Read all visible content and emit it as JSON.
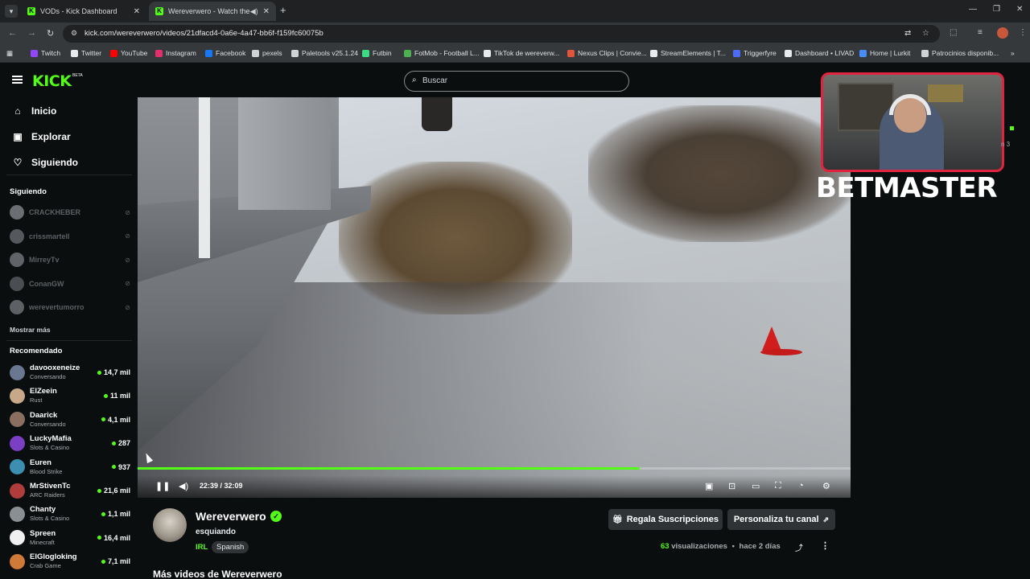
{
  "browser": {
    "tabs": [
      {
        "title": "VODs - Kick Dashboard",
        "active": false
      },
      {
        "title": "Wereverwero - Watch the V",
        "active": true
      }
    ],
    "url": "kick.com/wereverwero/videos/21dfacd4-0a6e-4a47-bb6f-f159fc60075b",
    "bookmarks": [
      {
        "label": "Twitch",
        "color": "#9146ff"
      },
      {
        "label": "Twitter",
        "color": "#e8eaed"
      },
      {
        "label": "YouTube",
        "color": "#ff0000"
      },
      {
        "label": "Instagram",
        "color": "#e1306c"
      },
      {
        "label": "Facebook",
        "color": "#1877f2"
      },
      {
        "label": "pexels",
        "color": "#cfd3d6"
      },
      {
        "label": "Paletools v25.1.24",
        "color": "#cfd3d6"
      },
      {
        "label": "Futbin",
        "color": "#3ddc84"
      },
      {
        "label": "FotMob - Football L...",
        "color": "#4caf50"
      },
      {
        "label": "TikTok de wereverw...",
        "color": "#e8eaed"
      },
      {
        "label": "Nexus Clips | Convie...",
        "color": "#e0563b"
      },
      {
        "label": "StreamElements | T...",
        "color": "#e8eaed"
      },
      {
        "label": "Triggerfyre",
        "color": "#4a6cf7"
      },
      {
        "label": "Dashboard • LIVAD",
        "color": "#e8eaed"
      },
      {
        "label": "Home | Lurkit",
        "color": "#4a8cf7"
      },
      {
        "label": "Patrocinios disponib...",
        "color": "#cfd3d6"
      }
    ]
  },
  "kick": {
    "logo": "KICK",
    "logo_badge": "BETA",
    "search_placeholder": "Buscar",
    "accent": "#53fc18",
    "nav": [
      {
        "label": "Inicio",
        "icon": "home-icon"
      },
      {
        "label": "Explorar",
        "icon": "compass-icon"
      },
      {
        "label": "Siguiendo",
        "icon": "heart-icon"
      }
    ],
    "following_heading": "Siguiendo",
    "following": [
      {
        "name": "CRACKHEBER"
      },
      {
        "name": "crissmartell"
      },
      {
        "name": "MirreyTv"
      },
      {
        "name": "ConanGW"
      },
      {
        "name": "werevertumorro"
      }
    ],
    "show_more": "Mostrar más",
    "recommended_heading": "Recomendado",
    "recommended": [
      {
        "name": "davooxeneize",
        "category": "Conversando",
        "viewers": "14,7 mil"
      },
      {
        "name": "ElZeein",
        "category": "Rust",
        "viewers": "11 mil"
      },
      {
        "name": "Daarick",
        "category": "Conversando",
        "viewers": "4,1 mil"
      },
      {
        "name": "LuckyMafia",
        "category": "Slots & Casino",
        "viewers": "287"
      },
      {
        "name": "Euren",
        "category": "Blood Strike",
        "viewers": "937"
      },
      {
        "name": "MrStivenTc",
        "category": "ARC Raiders",
        "viewers": "21,6 mil"
      },
      {
        "name": "Chanty",
        "category": "Slots & Casino",
        "viewers": "1,1 mil"
      },
      {
        "name": "Spreen",
        "category": "Minecraft",
        "viewers": "16,4 mil"
      },
      {
        "name": "ElGlogloking",
        "category": "Crab Game",
        "viewers": "7,1 mil"
      }
    ]
  },
  "player": {
    "time": "22:39 / 32:09",
    "progress": 0.704
  },
  "overlay": {
    "sponsor": "BETMASTER",
    "side_text": "n 3"
  },
  "channel": {
    "name": "Wereverwero",
    "video_title": "esquiando",
    "category": "IRL",
    "language": "Spanish",
    "gift_button": "Regala Suscripciones",
    "customize_button": "Personaliza tu canal",
    "views_count": "63",
    "views_label": "visualizaciones",
    "date": "hace 2 días",
    "more_videos": "Más videos de Wereverwero"
  }
}
